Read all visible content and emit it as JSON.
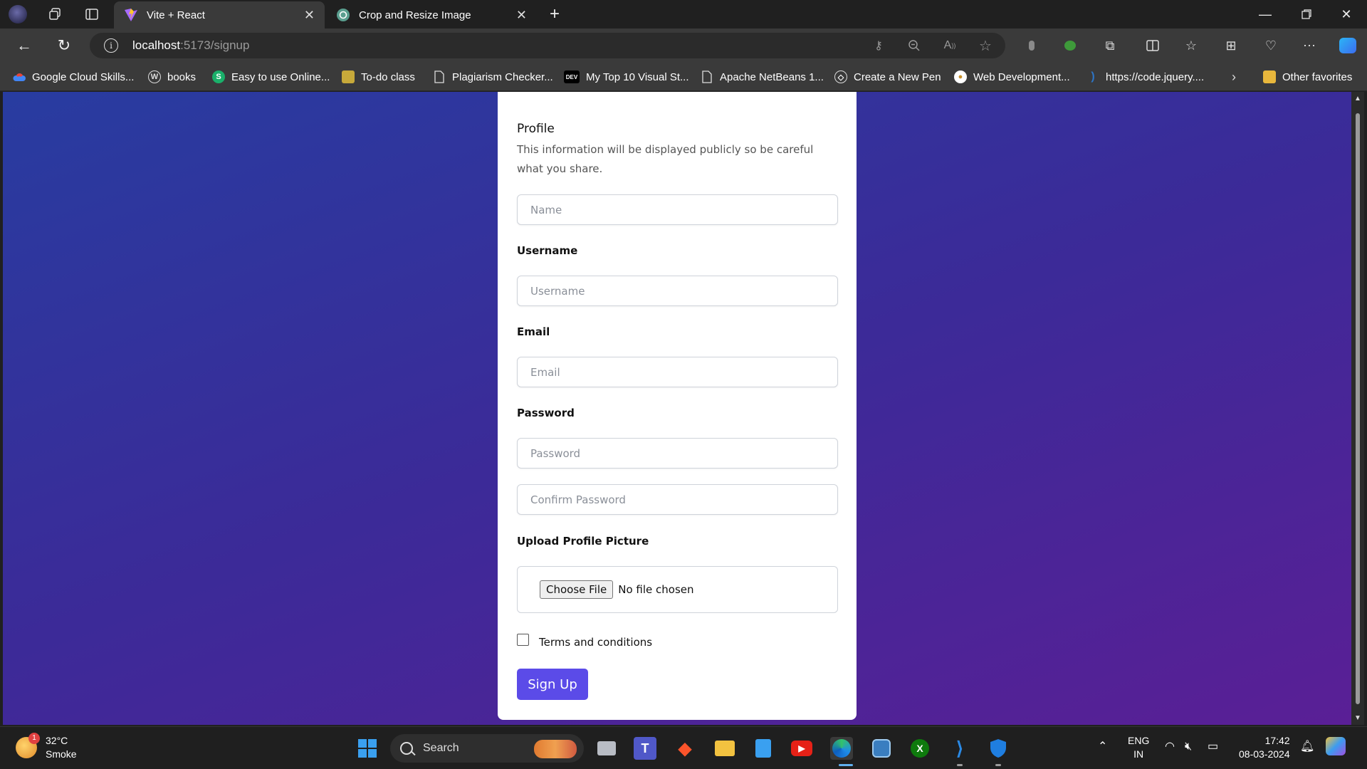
{
  "browser": {
    "tabs": [
      {
        "title": "Vite + React",
        "active": true
      },
      {
        "title": "Crop and Resize Image",
        "active": false
      }
    ],
    "address": {
      "host": "localhost",
      "path": ":5173/signup"
    },
    "favorites": [
      "Google Cloud Skills...",
      "books",
      "Easy to use Online...",
      "To-do class",
      "Plagiarism Checker...",
      "My Top 10 Visual St...",
      "Apache NetBeans 1...",
      "Create a New Pen",
      "Web Development...",
      "https://code.jquery....",
      "Other favorites"
    ],
    "fav_badges": {
      "dev": "DEV",
      "s": "S"
    }
  },
  "form": {
    "title": "Profile",
    "description": "This information will be displayed publicly so be careful what you share.",
    "name_placeholder": "Name",
    "username_label": "Username",
    "username_placeholder": "Username",
    "email_label": "Email",
    "email_placeholder": "Email",
    "password_label": "Password",
    "password_placeholder": "Password",
    "confirm_placeholder": "Confirm Password",
    "upload_label": "Upload Profile Picture",
    "file_button": "Choose File",
    "file_status": "No file chosen",
    "terms_label": "Terms and conditions",
    "submit_label": "Sign Up",
    "accent_color": "#5b4be8"
  },
  "taskbar": {
    "weather_temp": "32°C",
    "weather_desc": "Smoke",
    "weather_badge": "1",
    "search_label": "Search",
    "lang_top": "ENG",
    "lang_bottom": "IN",
    "time": "17:42",
    "date": "08-03-2024"
  }
}
